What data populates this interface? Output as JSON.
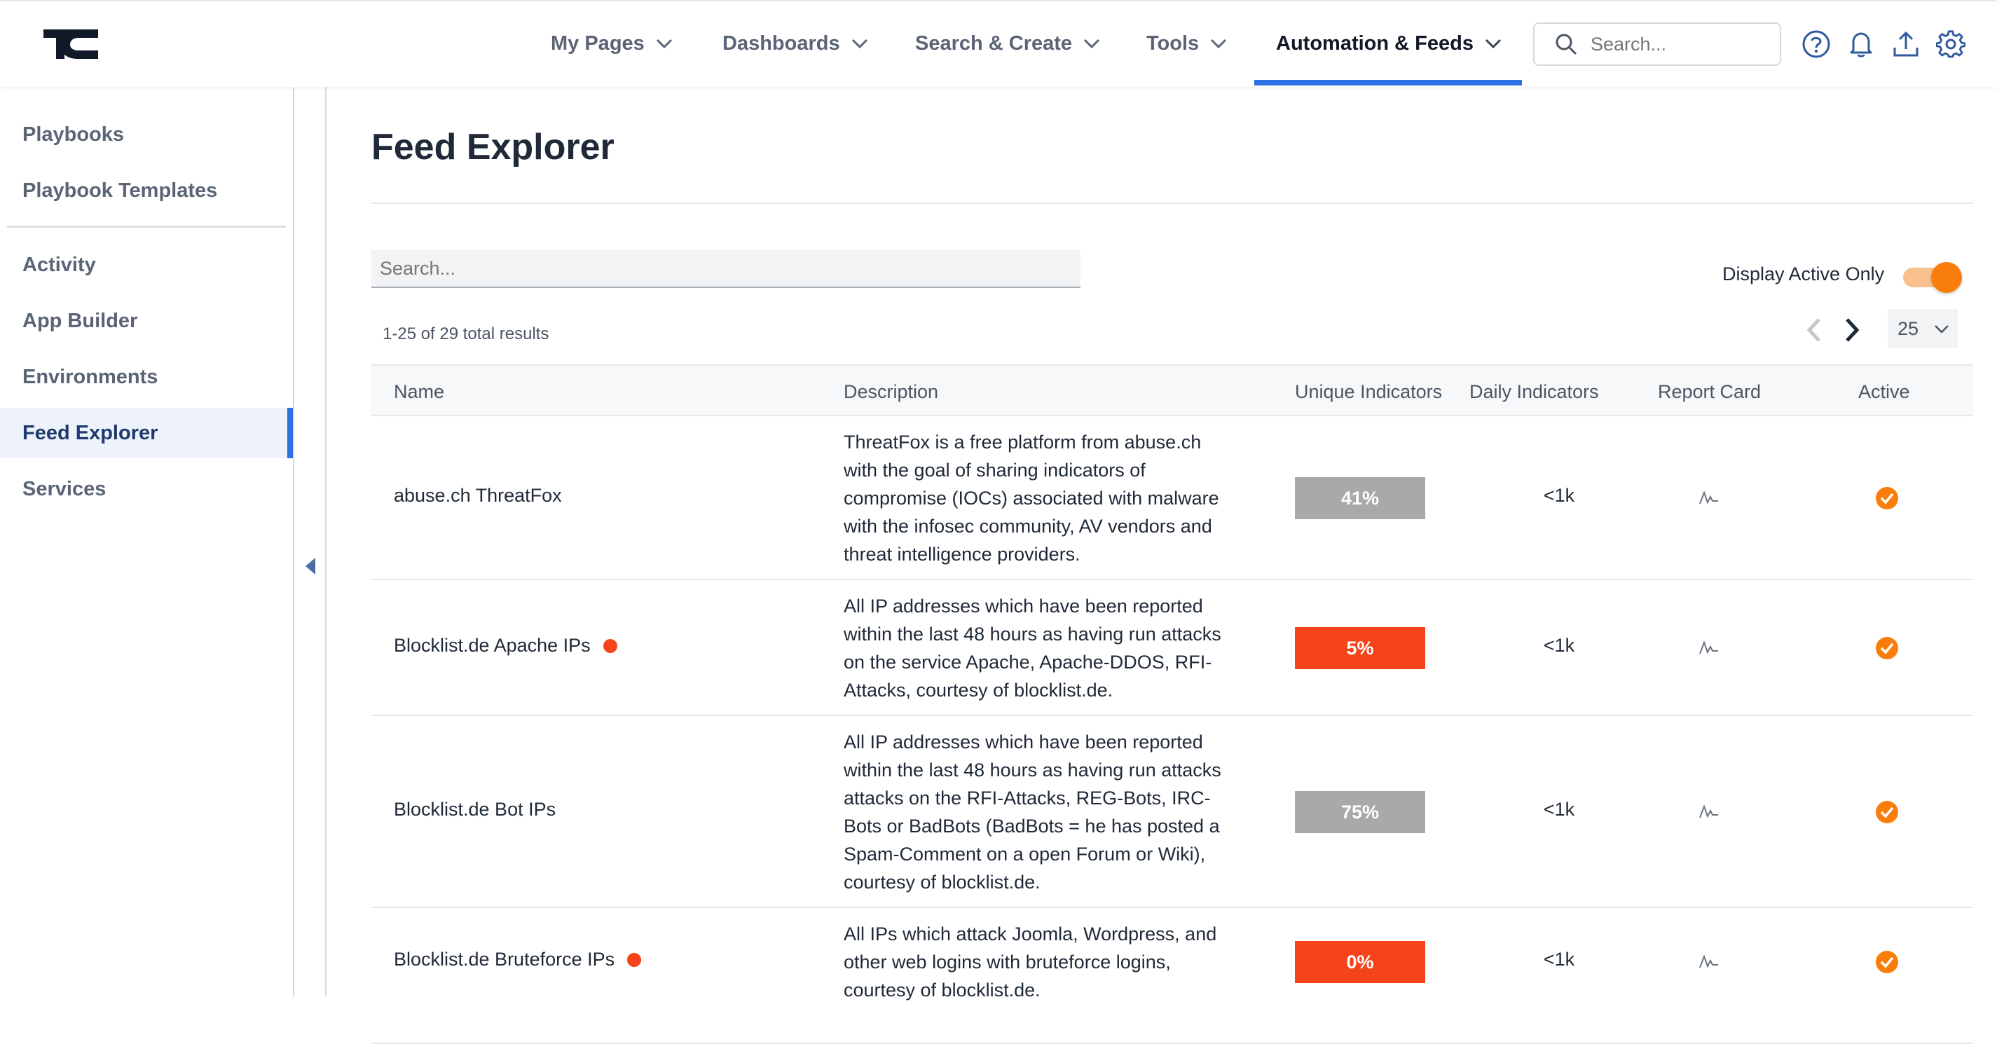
{
  "nav": {
    "items": [
      {
        "label": "My Pages"
      },
      {
        "label": "Dashboards"
      },
      {
        "label": "Search & Create"
      },
      {
        "label": "Tools"
      },
      {
        "label": "Automation & Feeds",
        "active": true
      }
    ],
    "search_placeholder": "Search...",
    "accent_color": "#2f6fe4"
  },
  "icons": {
    "top": [
      "help-icon",
      "bell-icon",
      "upload-icon",
      "gear-icon"
    ]
  },
  "sidebar": {
    "items": [
      {
        "label": "Playbooks"
      },
      {
        "label": "Playbook Templates"
      },
      {
        "label": "Activity"
      },
      {
        "label": "App Builder"
      },
      {
        "label": "Environments"
      },
      {
        "label": "Feed Explorer",
        "active": true
      },
      {
        "label": "Services"
      }
    ]
  },
  "main": {
    "title": "Feed Explorer",
    "search_placeholder": "Search...",
    "active_only_label": "Display Active Only",
    "active_only_on": true,
    "results_text": "1-25 of 29 total results",
    "page_size": "25"
  },
  "table": {
    "headers": [
      "Name",
      "Description",
      "Unique Indicators",
      "Daily Indicators",
      "Report Card",
      "Active"
    ],
    "rows": [
      {
        "name": "abuse.ch ThreatFox",
        "flag": false,
        "description_lines": [
          "ThreatFox is a free platform from abuse.ch",
          "with the goal of sharing indicators of",
          "compromise (IOCs) associated with malware",
          "with the infosec community, AV vendors and",
          "threat intelligence providers."
        ],
        "unique": "41%",
        "unique_color": "#a9a9a9",
        "daily": "<1k",
        "active": true
      },
      {
        "name": "Blocklist.de Apache IPs",
        "flag": true,
        "description_lines": [
          "All IP addresses which have been reported",
          "within the last 48 hours as having run attacks",
          "on the service Apache, Apache-DDOS, RFI-",
          "Attacks, courtesy of blocklist.de."
        ],
        "unique": "5%",
        "unique_color": "#f5431a",
        "daily": "<1k",
        "active": true
      },
      {
        "name": "Blocklist.de Bot IPs",
        "flag": false,
        "description_lines": [
          "All IP addresses which have been reported",
          "within the last 48 hours as having run attacks",
          "attacks on the RFI-Attacks, REG-Bots, IRC-",
          "Bots or BadBots (BadBots = he has posted a",
          "Spam-Comment on a open Forum or Wiki),",
          "courtesy of blocklist.de."
        ],
        "unique": "75%",
        "unique_color": "#a9a9a9",
        "daily": "<1k",
        "active": true
      },
      {
        "name": "Blocklist.de Bruteforce IPs",
        "flag": true,
        "description_lines": [
          "All IPs which attack Joomla, Wordpress, and",
          "other web logins with bruteforce logins,",
          "courtesy of blocklist.de."
        ],
        "unique": "0%",
        "unique_color": "#f5431a",
        "daily": "<1k",
        "active": true
      }
    ]
  }
}
